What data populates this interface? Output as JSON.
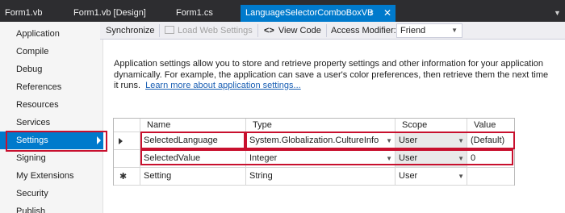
{
  "tabs": [
    {
      "label": "Form1.vb"
    },
    {
      "label": "Form1.vb [Design]"
    },
    {
      "label": "Form1.cs"
    },
    {
      "label": "LanguageSelectorComboBoxVB",
      "active": true
    }
  ],
  "nav": {
    "items": [
      {
        "label": "Application"
      },
      {
        "label": "Compile"
      },
      {
        "label": "Debug"
      },
      {
        "label": "References"
      },
      {
        "label": "Resources"
      },
      {
        "label": "Services"
      },
      {
        "label": "Settings",
        "selected": true
      },
      {
        "label": "Signing"
      },
      {
        "label": "My Extensions"
      },
      {
        "label": "Security"
      },
      {
        "label": "Publish"
      }
    ]
  },
  "toolbar": {
    "synchronize": "Synchronize",
    "load_web_settings": "Load Web Settings",
    "view_code": "View Code",
    "access_modifier_label": "Access Modifier:",
    "access_modifier_value": "Friend"
  },
  "description": {
    "text": "Application settings allow you to store and retrieve property settings and other information for your application dynamically. For example, the application can save a user's color preferences, then retrieve them the next time it runs.",
    "link": "Learn more about application settings..."
  },
  "grid": {
    "columns": [
      "Name",
      "Type",
      "Scope",
      "Value"
    ],
    "rows": [
      {
        "name": "SelectedLanguage",
        "type": "System.Globalization.CultureInfo",
        "scope": "User",
        "value": "(Default)"
      },
      {
        "name": "SelectedValue",
        "type": "Integer",
        "scope": "User",
        "value": "0"
      },
      {
        "name": "Setting",
        "type": "String",
        "scope": "User",
        "value": ""
      }
    ]
  },
  "colors": {
    "accent": "#007acc",
    "highlight": "#c8102e",
    "tabstrip": "#2d2d30"
  }
}
